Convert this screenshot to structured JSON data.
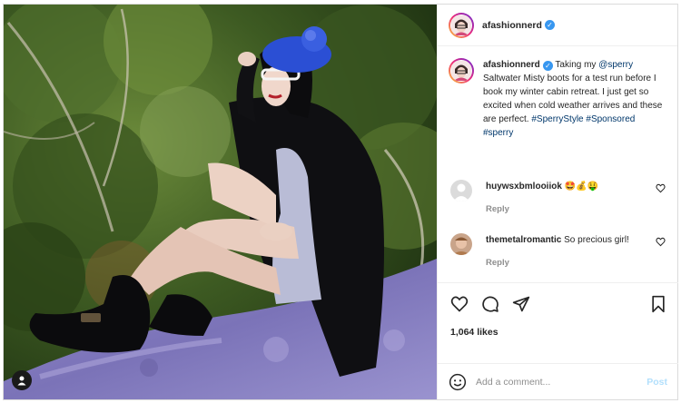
{
  "post": {
    "username": "afashionnerd",
    "verified": true,
    "caption": {
      "username": "afashionnerd",
      "text_1": "Taking my ",
      "mention": "@sperry",
      "text_2": " Saltwater Misty boots for a test run before I book my winter cabin retreat. I just get so excited when cold weather arrives and these are perfect. ",
      "hashtags": "#SperryStyle #Sponsored #sperry"
    },
    "comments": [
      {
        "username": "huywsxbmlooiiok",
        "text": "🤩💰🤑",
        "reply": "Reply"
      },
      {
        "username": "themetalromantic",
        "text": "So precious girl!",
        "reply": "Reply"
      }
    ],
    "likes": "1,064 likes",
    "add_comment_placeholder": "Add a comment...",
    "post_label": "Post"
  },
  "icons": {
    "verified": "verified-badge-icon",
    "like": "heart-icon",
    "comment": "comment-bubble-icon",
    "share": "paper-plane-icon",
    "save": "bookmark-icon",
    "emoji": "smiley-icon",
    "tag": "user-tag-icon"
  },
  "colors": {
    "link": "#00376b",
    "verified": "#3897f0",
    "post_disabled": "#b2dffc",
    "muted": "#8e8e8e"
  }
}
